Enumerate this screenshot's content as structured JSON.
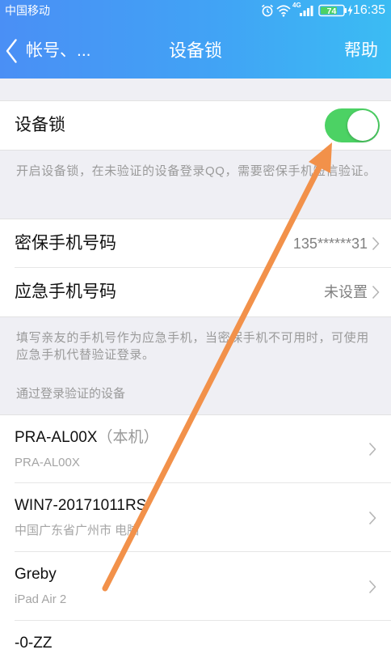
{
  "status_bar": {
    "carrier": "中国移动",
    "network": "4G",
    "battery": "74",
    "time": "16:35"
  },
  "nav": {
    "back_label": "帐号、...",
    "title": "设备锁",
    "help_label": "帮助"
  },
  "device_lock": {
    "label": "设备锁",
    "enabled": true,
    "description": "开启设备锁，在未验证的设备登录QQ，需要密保手机短信验证。"
  },
  "phones": {
    "items": [
      {
        "label": "密保手机号码",
        "value": "135******31"
      },
      {
        "label": "应急手机号码",
        "value": "未设置"
      }
    ],
    "description": "填写亲友的手机号作为应急手机，当密保手机不可用时，可使用应急手机代替验证登录。"
  },
  "devices": {
    "header": "通过登录验证的设备",
    "items": [
      {
        "name": "PRA-AL00X",
        "tag": "（本机）",
        "detail": "PRA-AL00X"
      },
      {
        "name": "WIN7-20171011RS",
        "detail": "中国广东省广州市 电脑"
      },
      {
        "name": "Greby",
        "detail": "iPad Air 2"
      },
      {
        "name": "-0-ZZ"
      }
    ]
  },
  "icons": {
    "status": [
      "alarm-icon",
      "wifi-icon",
      "signal-icon",
      "battery-icon",
      "charging-icon"
    ],
    "back": "chevron-left-icon",
    "row_disclosure": "chevron-right-icon",
    "annotation": "annotation-arrow"
  },
  "colors": {
    "header_gradient_start": "#4a8ff5",
    "header_gradient_end": "#3bbcf3",
    "toggle_on": "#4cd264",
    "page_background": "#efeff4",
    "annotation_arrow": "#f2914a"
  }
}
